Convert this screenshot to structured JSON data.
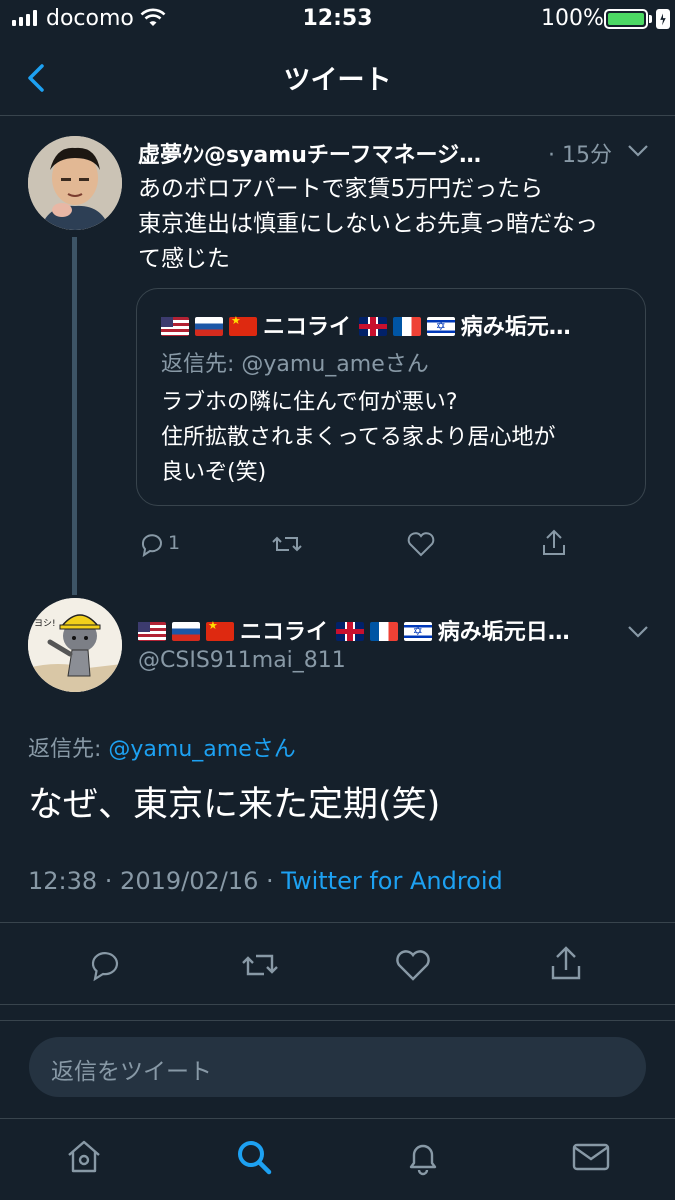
{
  "status_bar": {
    "carrier": "docomo",
    "time": "12:53",
    "battery": "100%"
  },
  "nav": {
    "title": "ツイート"
  },
  "tweet1": {
    "display_name": "虚夢ｸﾝ@syamuチーフマネージ…",
    "time": "· 15分",
    "text_lines": [
      "あのボロアパートで家賃5万円だったら",
      "東京進出は慎重にしないとお先真っ暗だなっ",
      "て感じた"
    ],
    "reply_count": "1",
    "quote": {
      "flag_icons": [
        "flag-us",
        "flag-ru",
        "flag-cn"
      ],
      "name_part1": "ニコライ",
      "flag_icons2": [
        "flag-uk",
        "flag-fr",
        "flag-il"
      ],
      "name_part2": "病み垢元…",
      "reply_to": "返信先: @yamu_ameさん",
      "text_lines": [
        "ラブホの隣に住んで何が悪い?",
        "住所拡散されまくってる家より居心地が",
        "良いぞ(笑)"
      ]
    }
  },
  "tweet2": {
    "flag_icons": [
      "flag-us",
      "flag-ru",
      "flag-cn"
    ],
    "name_part1": "ニコライ",
    "flag_icons2": [
      "flag-uk",
      "flag-fr",
      "flag-il"
    ],
    "name_part2": "病み垢元日…",
    "handle": "@CSIS911mai_811",
    "reply_prefix": "返信先: ",
    "reply_mention": "@yamu_ameさん",
    "text": "なぜ、東京に来た定期(笑)",
    "timestamp": "12:38 · 2019/02/16 · ",
    "source": "Twitter for Android"
  },
  "reply_bar": {
    "placeholder": "返信をツイート"
  },
  "tab_bar": {
    "items": [
      "home-icon",
      "search-icon",
      "notifications-icon",
      "messages-icon"
    ],
    "active_color": "#1da1f2"
  },
  "colors": {
    "background": "#15202b",
    "accent": "#1da1f2",
    "secondary_text": "#8899a6"
  }
}
